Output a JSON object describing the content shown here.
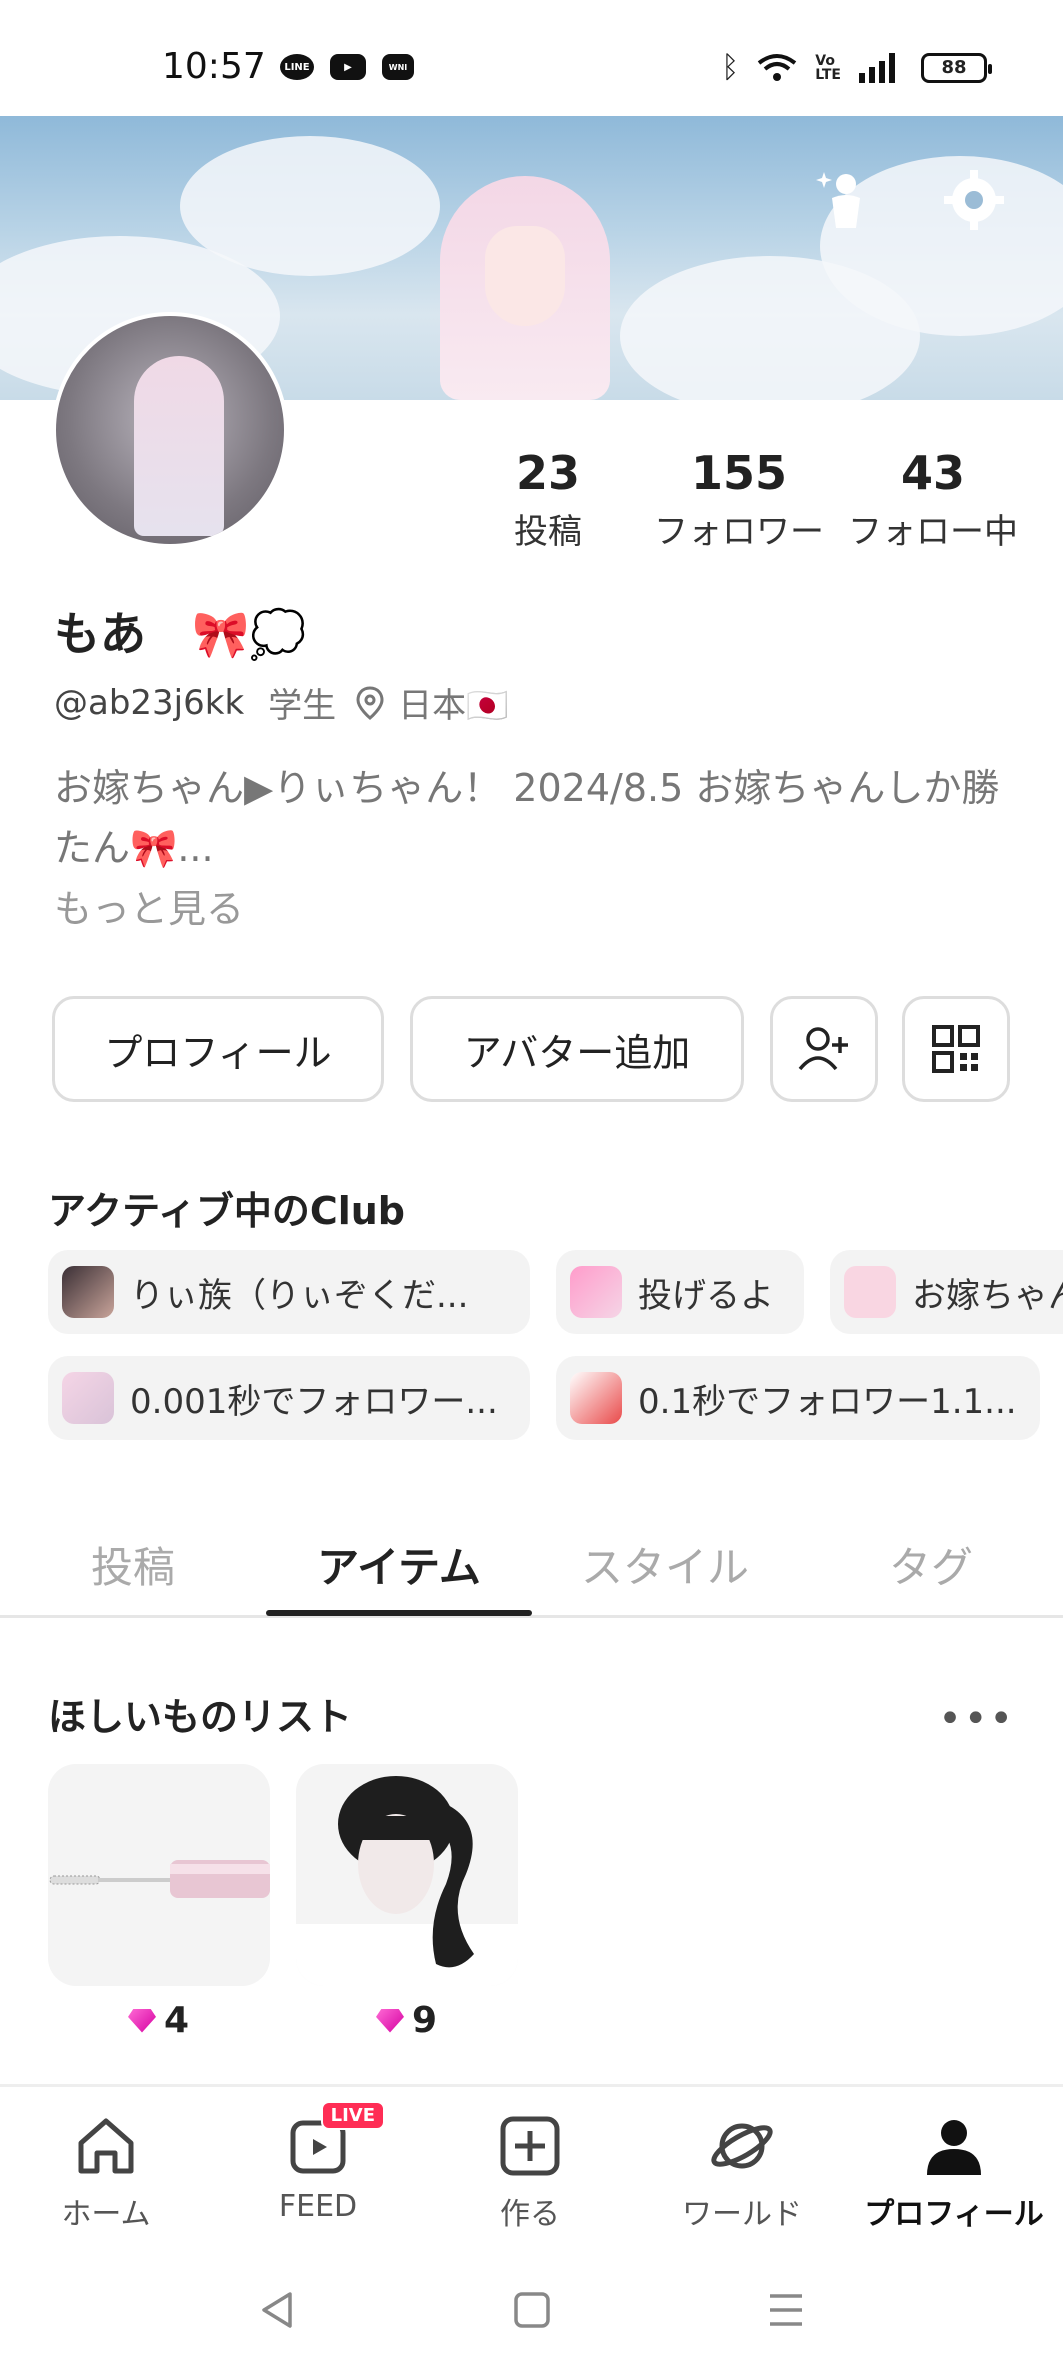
{
  "status_bar": {
    "time": "10:57",
    "apps": [
      "LINE",
      "YouTube",
      "WNI"
    ],
    "battery": "88"
  },
  "profile": {
    "stats": [
      {
        "value": "23",
        "label": "投稿"
      },
      {
        "value": "155",
        "label": "フォロワー"
      },
      {
        "value": "43",
        "label": "フォロー中"
      }
    ],
    "name": "もあ　🎀💭",
    "handle": "@ab23j6kk",
    "occupation": "学生",
    "location": "日本🇯🇵",
    "bio": "お嫁ちゃん▶りぃちゃん！ 2024/8.5 お嫁ちゃんしか勝たん🎀...",
    "more_label": "もっと見る"
  },
  "actions": {
    "edit_profile": "プロフィール",
    "add_avatar": "アバター追加"
  },
  "clubs": {
    "title": "アクティブ中のClub",
    "items": [
      {
        "label": "りぃ族（りぃぞくだ..."
      },
      {
        "label": "投げるよ"
      },
      {
        "label": "お嫁ちゃん"
      },
      {
        "label": "0.001秒でフォロワー..."
      },
      {
        "label": "0.1秒でフォロワー1.1..."
      }
    ]
  },
  "tabs": [
    {
      "label": "投稿"
    },
    {
      "label": "アイテム"
    },
    {
      "label": "スタイル"
    },
    {
      "label": "タグ"
    }
  ],
  "wishlist": {
    "title": "ほしいものリスト",
    "more": "•••",
    "items": [
      {
        "price": "4"
      },
      {
        "price": "9"
      }
    ]
  },
  "bottom_nav": [
    {
      "label": "ホーム",
      "icon": "home-icon"
    },
    {
      "label": "FEED",
      "icon": "feed-icon",
      "badge": "LIVE"
    },
    {
      "label": "作る",
      "icon": "create-icon"
    },
    {
      "label": "ワールド",
      "icon": "world-icon"
    },
    {
      "label": "プロフィール",
      "icon": "profile-icon"
    }
  ],
  "colors": {
    "accent": "#222222",
    "live_badge": "#ff2d55",
    "gem": "#e83dc8"
  }
}
